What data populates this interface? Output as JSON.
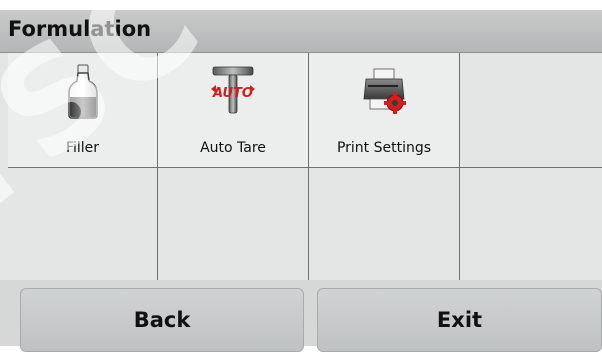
{
  "header": {
    "title": "Formulation"
  },
  "menu": {
    "items": [
      {
        "label": "Filler",
        "icon": "filler-bottle-icon"
      },
      {
        "label": "Auto Tare",
        "icon": "auto-tare-icon",
        "icon_text": "AUTO"
      },
      {
        "label": "Print Settings",
        "icon": "printer-settings-icon"
      }
    ]
  },
  "footer": {
    "back_label": "Back",
    "exit_label": "Exit"
  },
  "watermark": {
    "text": "TSC"
  },
  "colors": {
    "accent_red": "#d01f1f",
    "title_bar": "#bfc1c2",
    "background": "#e4e6e6"
  }
}
